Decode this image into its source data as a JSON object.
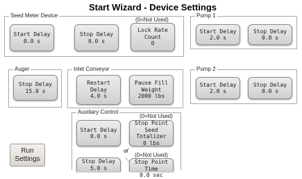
{
  "title": "Start Wizard - Device Settings",
  "groups": {
    "seed_meter": {
      "label": "Seed Meter Device",
      "start_delay": {
        "label": "Start Delay",
        "value": "0.0 s"
      },
      "stop_delay": {
        "label": "Stop Delay",
        "value": "0.0 s"
      },
      "lock_rate_note": "(0=Not Used)",
      "lock_rate": {
        "line1": "Lock Rate",
        "line2": "Count",
        "value": "0"
      }
    },
    "pump1": {
      "label": "Pump 1",
      "start_delay": {
        "label": "Start Delay",
        "value": "2.0 s"
      },
      "stop_delay": {
        "label": "Stop Delay",
        "value": "0.0 s"
      }
    },
    "auger": {
      "label": "Auger",
      "stop_delay": {
        "label": "Stop Delay",
        "value": "15.0 s"
      }
    },
    "inlet_conveyor": {
      "label": "Inlet Conveyor",
      "restart_delay": {
        "line1": "Restart",
        "line2": "Delay",
        "value": "4.0 s"
      },
      "pause_fill_weight": {
        "line1": "Pause Fill",
        "line2": "Weight",
        "value": "2000 lbs"
      }
    },
    "pump2": {
      "label": "Pump 2",
      "start_delay": {
        "label": "Start Delay",
        "value": "2.0 s"
      },
      "stop_delay": {
        "label": "Stop Delay",
        "value": "0.0 s"
      }
    },
    "auxiliary": {
      "label": "Auxiliary Control",
      "note1": "(0=Not Used)",
      "start_delay": {
        "label": "Start Delay",
        "value": "0.0 s"
      },
      "stop_point_totalizer": {
        "line1": "Stop Point",
        "line2": "Seed Totalizer",
        "value": "0 lbs"
      },
      "or_text": "or",
      "note2": "(0=Not Used)",
      "stop_delay": {
        "label": "Stop Delay",
        "value": "5.0 s"
      },
      "stop_point_time": {
        "line1": "Stop Point",
        "line2": "Time",
        "value": "0.0 sec"
      }
    }
  },
  "run_settings": {
    "line1": "Run",
    "line2": "Settings"
  }
}
